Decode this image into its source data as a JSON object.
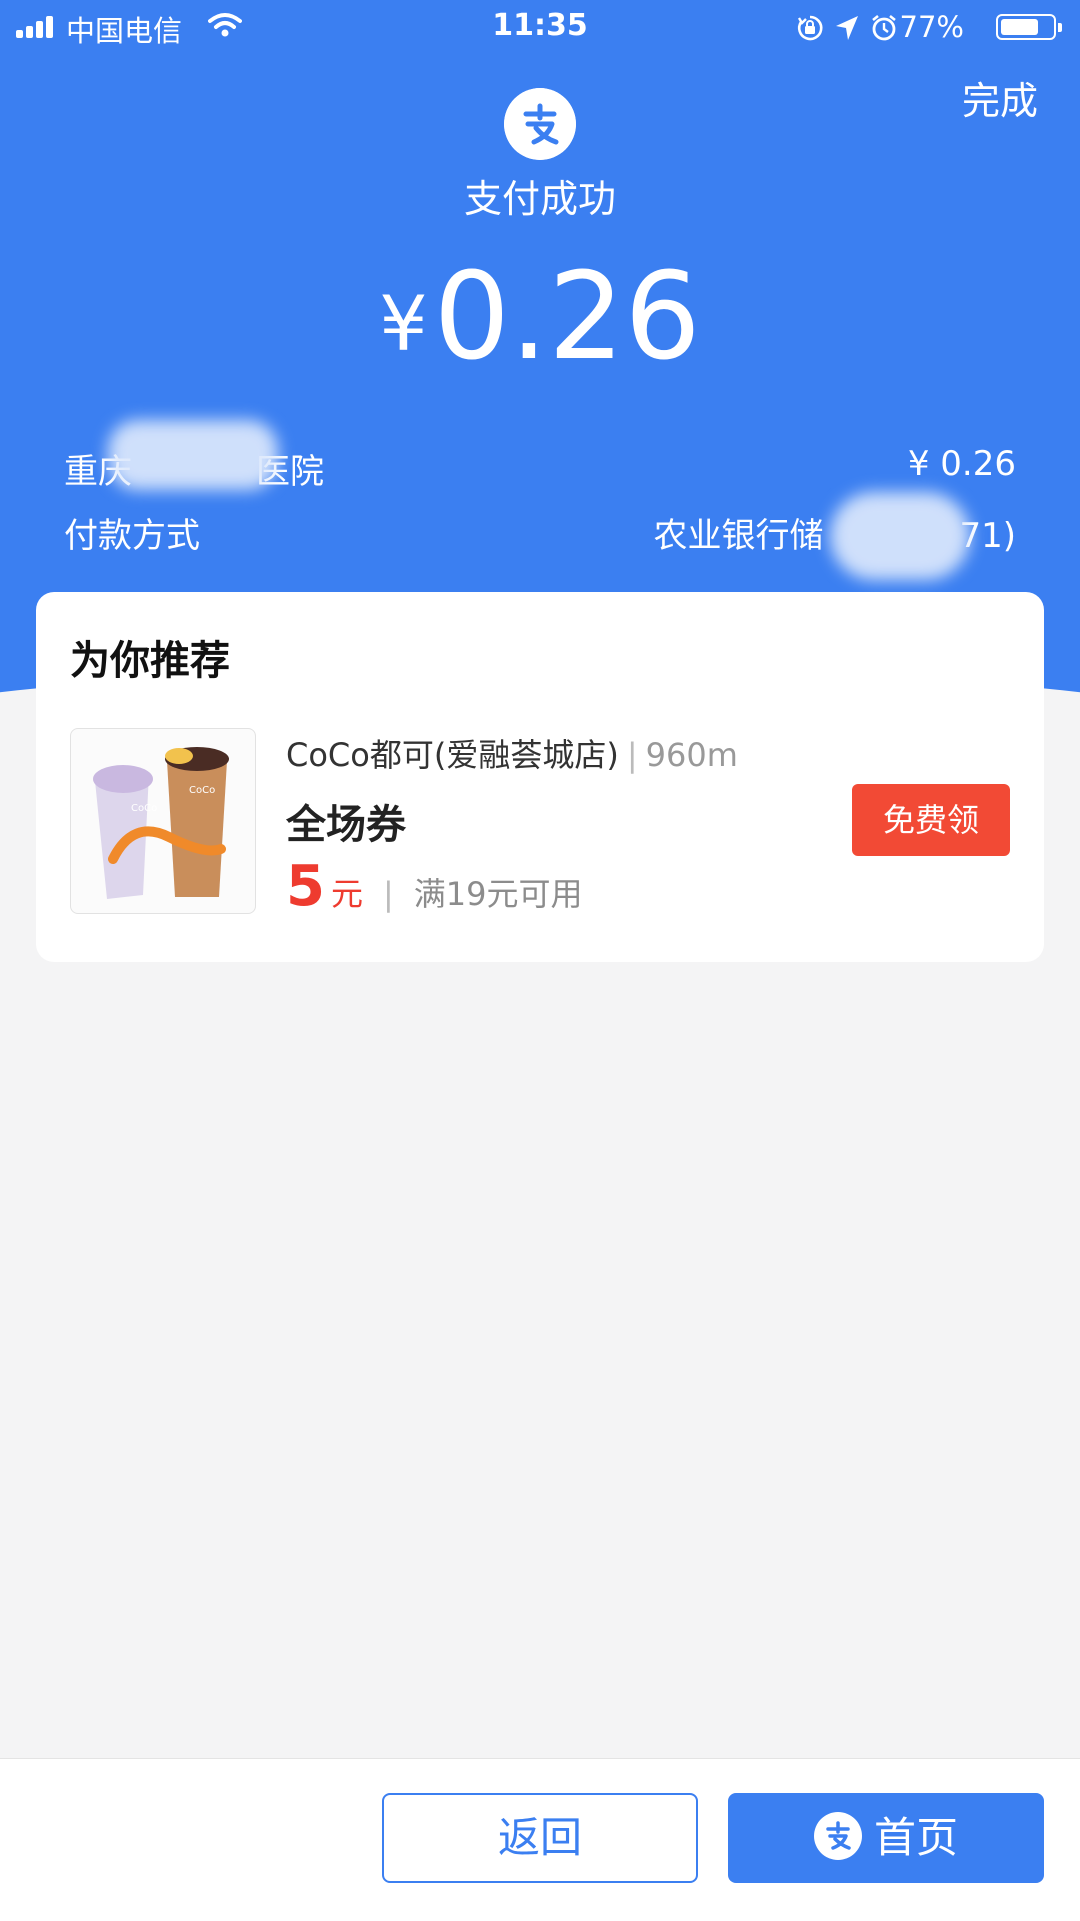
{
  "status_bar": {
    "carrier": "中国电信",
    "time": "11:35",
    "battery_percent": "77%",
    "battery_level": 0.77,
    "icons": [
      "signal-icon",
      "wifi-icon",
      "rotation-lock-icon",
      "location-icon",
      "alarm-icon",
      "battery-icon"
    ]
  },
  "header": {
    "done_label": "完成",
    "logo_icon": "alipay-icon",
    "title": "支付成功",
    "currency_symbol": "¥",
    "amount": "0.26"
  },
  "payee": {
    "name_prefix": "重庆",
    "name_suffix": "医院",
    "amount": "¥ 0.26"
  },
  "payment_method": {
    "label": "付款方式",
    "value_prefix": "农业银行储",
    "value_suffix": "71)"
  },
  "recommend": {
    "title": "为你推荐",
    "item": {
      "image_icon": "bubble-tea-image",
      "shop": "CoCo都可(爱融荟城店)",
      "separator": "|",
      "distance": "960m",
      "coupon_name": "全场券",
      "value": "5",
      "unit": "元",
      "divider": "|",
      "condition": "满19元可用",
      "claim_label": "免费领"
    }
  },
  "bottom": {
    "back_label": "返回",
    "home_label": "首页"
  },
  "colors": {
    "brand_blue": "#3b7ff1",
    "coupon_red": "#f24a35",
    "page_bg": "#f4f4f5"
  }
}
